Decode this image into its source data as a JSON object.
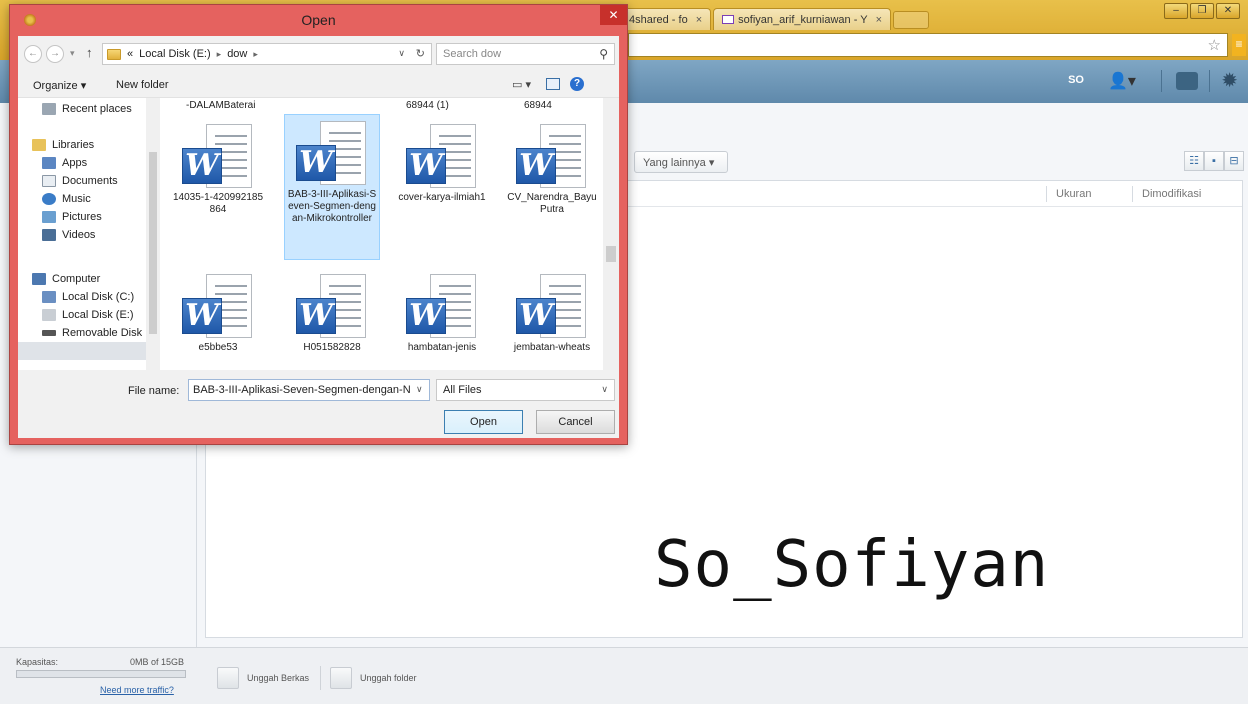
{
  "browser": {
    "tabs": [
      {
        "label": "4shared - fo",
        "close": "×"
      },
      {
        "label": "sofiyan_arif_kurniawan - Y",
        "close": "×"
      }
    ],
    "window_controls": [
      "–",
      "❐",
      "✕"
    ]
  },
  "app_header": {
    "user": "SO"
  },
  "main": {
    "more_button": "Yang lainnya ▾",
    "columns": {
      "size": "Ukuran",
      "modified": "Dimodifikasi"
    }
  },
  "watermark": "So_Sofiyan",
  "footer": {
    "capacity_label": "Kapasitas:",
    "capacity_value": "0MB of 15GB",
    "capacity_used_fraction": 0.0,
    "more_traffic": "Need more traffic?",
    "upload_file": "Unggah Berkas",
    "upload_folder": "Unggah folder"
  },
  "dialog": {
    "title": "Open",
    "close_label": "✕",
    "breadcrumb": {
      "prefix": "«",
      "items": [
        "Local Disk (E:)",
        "dow"
      ]
    },
    "search_placeholder": "Search dow",
    "toolbar": {
      "organize": "Organize ▾",
      "new_folder": "New folder"
    },
    "nav": {
      "recent_places": "Recent places",
      "libraries": "Libraries",
      "apps": "Apps",
      "documents": "Documents",
      "music": "Music",
      "pictures": "Pictures",
      "videos": "Videos",
      "computer": "Computer",
      "local_c": "Local Disk (C:)",
      "local_e": "Local Disk (E:)",
      "removable": "Removable Disk"
    },
    "partial_names": [
      "-DALAMBaterai",
      "68944 (1)",
      "68944"
    ],
    "files": [
      {
        "name": "14035-1-420992185864"
      },
      {
        "name": "BAB-3-III-Aplikasi-Seven-Segmen-dengan-Mikrokontroller"
      },
      {
        "name": "cover-karya-ilmiah1"
      },
      {
        "name": "CV_Narendra_BayuPutra"
      },
      {
        "name": "e5bbe53"
      },
      {
        "name": "H051582828"
      },
      {
        "name": "hambatan-jenis"
      },
      {
        "name": "jembatan-wheats"
      }
    ],
    "selected_file_index": 1,
    "file_name_label": "File name:",
    "file_name_value": "BAB-3-III-Aplikasi-Seven-Segmen-dengan-N",
    "filter_value": "All Files",
    "open_button": "Open",
    "cancel_button": "Cancel"
  },
  "colors": {
    "dialog_frame": "#e5625f",
    "browser_frame": "#d9a52a",
    "header": "#6a92b3",
    "selection": "#cde8ff"
  }
}
